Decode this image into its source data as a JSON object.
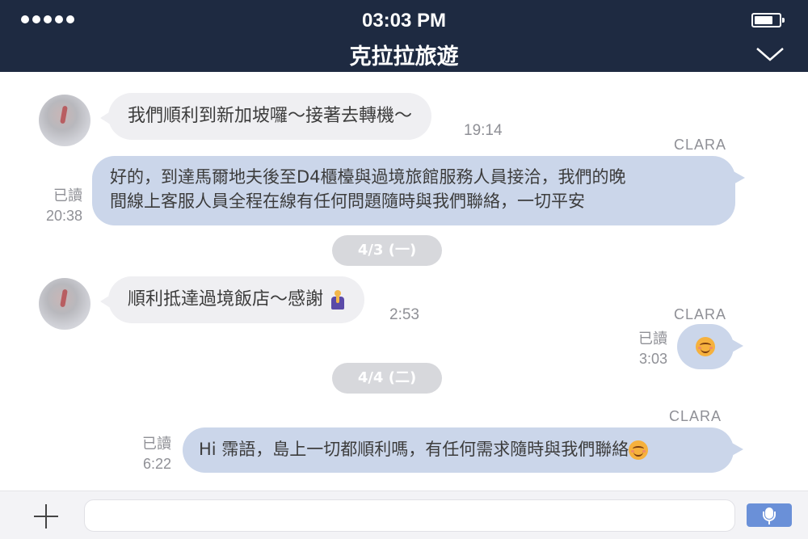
{
  "status_bar": {
    "time": "03:03 PM"
  },
  "header": {
    "title": "克拉拉旅遊"
  },
  "messages": {
    "m1": {
      "text": "我們順利到新加坡囉～接著去轉機～",
      "time": "19:14"
    },
    "m2": {
      "sender": "CLARA",
      "read": "已讀",
      "time": "20:38",
      "line1": "好的，到達馬爾地夫後至D4櫃檯與過境旅館服務人員接洽，我們的晚",
      "line2": "間線上客服人員全程在線有任何問題隨時與我們聯絡，一切平安"
    },
    "date1": "4/3 (一)",
    "m3": {
      "text": "順利抵達過境飯店～感謝",
      "emoji": "pray-emoji",
      "time": "2:53"
    },
    "m4": {
      "sender": "CLARA",
      "read": "已讀",
      "time": "3:03",
      "emoji": "smile-emoji"
    },
    "date2": "4/4 (二)",
    "m5": {
      "sender": "CLARA",
      "read": "已讀",
      "time": "6:22",
      "text": "Hi 霈語，島上一切都順利嗎，有任何需求隨時與我們聯絡",
      "emoji": "smile-emoji"
    }
  },
  "input_bar": {
    "value": ""
  },
  "colors": {
    "header_bg": "#1e2a41",
    "outgoing_bubble": "#cbd6ea",
    "incoming_bubble": "#efeff2",
    "mic_button": "#6a90d8"
  }
}
